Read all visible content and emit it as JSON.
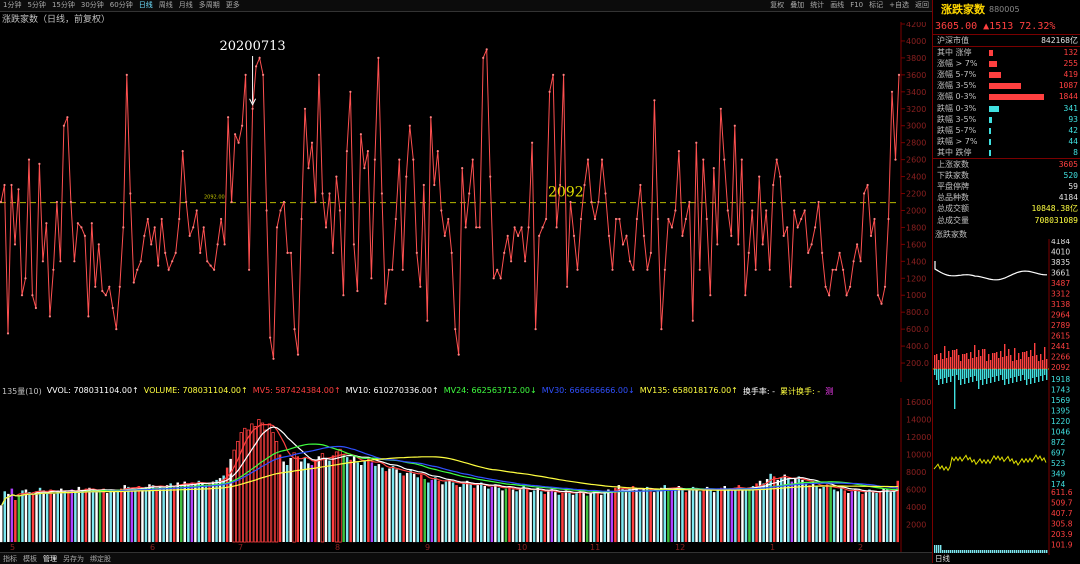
{
  "toolbar": {
    "left": [
      "1分钟",
      "5分钟",
      "15分钟",
      "30分钟",
      "60分钟",
      "日线",
      "周线",
      "月线",
      "多周期",
      "更多"
    ],
    "active": "日线",
    "right": [
      "复权",
      "叠加",
      "统计",
      "画线",
      "F10",
      "标记",
      "+自选",
      "返回"
    ]
  },
  "chart_title": "涨跌家数（日线，前复权）",
  "annotation_date": "20200713",
  "reference_line": {
    "value": 2092,
    "label": "2092",
    "small_label": "2092.00"
  },
  "price_axis": [
    "4200",
    "4000",
    "3800",
    "3600",
    "3400",
    "3200",
    "3000",
    "2800",
    "2600",
    "2400",
    "2200",
    "2000",
    "1800",
    "1600",
    "1400",
    "1200",
    "1000",
    "800.0",
    "600.0",
    "400.0",
    "200.0"
  ],
  "volume_axis": [
    "16000",
    "14000",
    "12000",
    "10000",
    "8000",
    "6000",
    "4000",
    "2000"
  ],
  "volume_info": [
    {
      "text": "135量(10)",
      "color": "#c0c0c0"
    },
    {
      "text": "VVOL: 708031104.00↑",
      "color": "#ffffff"
    },
    {
      "text": "VOLUME: 708031104.00↑",
      "color": "#ffff40"
    },
    {
      "text": "MV5: 587424384.00↑",
      "color": "#ff4040"
    },
    {
      "text": "MV10: 610270336.00↑",
      "color": "#ffffff"
    },
    {
      "text": "MV24: 662563712.00↓",
      "color": "#40ff40"
    },
    {
      "text": "MV30: 666666666.00↓",
      "color": "#3050ff"
    },
    {
      "text": "MV135: 658018176.00↑",
      "color": "#ffff40"
    },
    {
      "text": "换手率: -",
      "color": "#ffffff"
    },
    {
      "text": "累计换手: -",
      "color": "#ffff40"
    },
    {
      "text": "测",
      "color": "#ff40ff"
    }
  ],
  "month_labels": [
    "5",
    "6",
    "7",
    "8",
    "9",
    "10",
    "11",
    "12",
    "1",
    "2"
  ],
  "bottom_tabs": [
    "指标",
    "模板",
    "管理",
    "另存为",
    "绑定股"
  ],
  "bottom_active": "管理",
  "panel": {
    "name": "涨跌家数",
    "code": "880005",
    "price": "3605.00",
    "change": "▲1513",
    "pct": "72.32%",
    "market_label": "沪深市值",
    "market_value": "842168亿",
    "breakdown": [
      {
        "label": "其中 涨停",
        "value": "132",
        "color": "#ff4040",
        "bar": 132
      },
      {
        "label": "涨幅 > 7%",
        "value": "255",
        "color": "#ff4040",
        "bar": 255
      },
      {
        "label": "涨幅 5-7%",
        "value": "419",
        "color": "#ff4040",
        "bar": 419
      },
      {
        "label": "涨幅 3-5%",
        "value": "1087",
        "color": "#ff4040",
        "bar": 1087
      },
      {
        "label": "涨幅 0-3%",
        "value": "1844",
        "color": "#ff4040",
        "bar": 1844
      },
      {
        "label": "跌幅 0-3%",
        "value": "341",
        "color": "#40e0e0",
        "bar": 341
      },
      {
        "label": "跌幅 3-5%",
        "value": "93",
        "color": "#40e0e0",
        "bar": 93
      },
      {
        "label": "跌幅 5-7%",
        "value": "42",
        "color": "#40e0e0",
        "bar": 42
      },
      {
        "label": "跌幅 > 7%",
        "value": "44",
        "color": "#40e0e0",
        "bar": 44
      },
      {
        "label": "其中 跌停",
        "value": "8",
        "color": "#40e0e0",
        "bar": 8
      }
    ],
    "stats": [
      {
        "label": "上涨家数",
        "value": "3605",
        "color": "#ff4040"
      },
      {
        "label": "下跌家数",
        "value": "520",
        "color": "#40e0e0"
      },
      {
        "label": "平盘停牌",
        "value": "59",
        "color": "#e0e0e0"
      },
      {
        "label": "总品种数",
        "value": "4184",
        "color": "#e0e0e0"
      },
      {
        "label": "总成交额",
        "value": "10848.38亿",
        "color": "#ffff40"
      },
      {
        "label": "总成交量",
        "value": "708031089",
        "color": "#ffff40"
      }
    ],
    "mini_title": "涨跌家数",
    "mini_axis_upper": [
      "4184",
      "4010",
      "3835",
      "3661",
      "3487",
      "3312",
      "3138",
      "2964",
      "2789",
      "2615",
      "2441",
      "2266",
      "2092"
    ],
    "mini_axis_lower": [
      "1918",
      "1743",
      "1569",
      "1395",
      "1220",
      "1046",
      "872",
      "697",
      "523",
      "349",
      "174"
    ],
    "vol_axis": [
      "611.6",
      "509.7",
      "407.7",
      "305.8",
      "203.9",
      "101.9"
    ],
    "bottom_label": "日线"
  },
  "colors": {
    "up": "#ff4040",
    "down": "#40e0e0",
    "ref": "#b8b800",
    "accent": "#ffd700"
  },
  "chart_data": {
    "type": "line",
    "title": "涨跌家数（日线，前复权）",
    "ylim": [
      0,
      4200
    ],
    "series": [
      {
        "values": [
          2100,
          2300,
          550,
          2300,
          1600,
          2250,
          1000,
          1200,
          2600,
          1000,
          850,
          2550,
          1400,
          1850,
          750,
          1300,
          2100,
          1400,
          3000,
          3100,
          2100,
          1400,
          1850,
          1800,
          1700,
          750,
          1850,
          1100,
          1600,
          1050,
          1000,
          1100,
          850,
          600,
          1100,
          1800,
          3600,
          2200,
          1150,
          1300,
          1400,
          1700,
          1900,
          1600,
          1800,
          1350,
          1900,
          1500,
          1300,
          1400,
          1500,
          1900,
          2700,
          2100,
          1700,
          1800,
          2000,
          1500,
          1800,
          1400,
          1350,
          1300,
          1600,
          1900,
          1600,
          3100,
          2100,
          2900,
          2800,
          3000,
          3600,
          1300,
          3200,
          3700,
          3800,
          3600,
          2000,
          500,
          250,
          1800,
          2000,
          2100,
          1500,
          1500,
          600,
          300,
          1900,
          3200,
          2500,
          2800,
          2100,
          3600,
          2200,
          1800,
          2200,
          1500,
          2400,
          2000,
          1000,
          2700,
          3400,
          1600,
          1050,
          2900,
          2500,
          2700,
          1200,
          2600,
          3800,
          2200,
          900,
          1300,
          1300,
          1900,
          2600,
          1300,
          2400,
          3000,
          2600,
          1500,
          1100,
          2300,
          700,
          3100,
          2300,
          2700,
          2000,
          1700,
          1900,
          1500,
          600,
          300,
          2500,
          1800,
          2200,
          2600,
          1800,
          1800,
          3800,
          3900,
          2400,
          1200,
          1300,
          1200,
          1500,
          1700,
          1400,
          1800,
          1700,
          1800,
          1400,
          1800,
          2800,
          600,
          1700,
          1800,
          1900,
          3400,
          3600,
          1800,
          2300,
          3600,
          1100,
          2100,
          1700,
          1300,
          1900,
          2300,
          2600,
          2100,
          1900,
          2100,
          2600,
          2200,
          1700,
          1300,
          1900,
          1900,
          1600,
          1700,
          1400,
          1300,
          1900,
          2300,
          1700,
          1300,
          1500,
          3300,
          1900,
          600,
          1300,
          1900,
          1800,
          2000,
          2700,
          1700,
          1900,
          2100,
          700,
          2800,
          1300,
          2600,
          1900,
          1000,
          2500,
          1600,
          3200,
          2600,
          2000,
          1700,
          3000,
          1600,
          2600,
          1000,
          1500,
          2000,
          1300,
          2400,
          1600,
          2000,
          1300,
          2300,
          2600,
          2400,
          1700,
          1800,
          1100,
          2000,
          1800,
          1900,
          2000,
          1500,
          1600,
          1800,
          2100,
          1500,
          1100,
          1000,
          1300,
          1300,
          1500,
          1300,
          1000,
          1100,
          1400,
          1600,
          1400,
          2200,
          2300,
          1700,
          1900,
          1000,
          900,
          1100,
          1900,
          3400,
          2600,
          3600
        ]
      }
    ],
    "volume": [
      4200,
      5800,
      5500,
      6100,
      4800,
      5200,
      5900,
      6000,
      5700,
      5400,
      5800,
      6200,
      5900,
      5600,
      6000,
      5500,
      5900,
      6100,
      5800,
      5600,
      6000,
      5700,
      6300,
      5900,
      6100,
      6200,
      5800,
      5700,
      6000,
      6100,
      5600,
      5900,
      6000,
      5800,
      6100,
      6500,
      6300,
      6200,
      6000,
      6400,
      6100,
      6300,
      6600,
      6500,
      6200,
      6400,
      6100,
      6500,
      6700,
      6300,
      6800,
      6500,
      6900,
      6700,
      6800,
      6600,
      7000,
      6800,
      6500,
      6700,
      6900,
      7100,
      7300,
      7600,
      8500,
      9500,
      10500,
      11500,
      12500,
      13000,
      12800,
      13500,
      13200,
      14000,
      13600,
      12800,
      13500,
      12500,
      11500,
      10000,
      9200,
      8800,
      9600,
      10200,
      9800,
      9200,
      9600,
      9000,
      8800,
      9400,
      9800,
      10100,
      9600,
      9300,
      9900,
      10300,
      10600,
      10000,
      9700,
      9400,
      9800,
      9100,
      8800,
      9300,
      9700,
      9100,
      8700,
      8900,
      8500,
      8100,
      8400,
      8700,
      8300,
      7900,
      7600,
      7900,
      8300,
      7800,
      7400,
      7700,
      7200,
      6800,
      7100,
      7400,
      7000,
      6600,
      6900,
      7200,
      6800,
      6500,
      6300,
      6700,
      7000,
      6600,
      6200,
      6500,
      6800,
      6400,
      6100,
      6300,
      6600,
      6200,
      5900,
      6100,
      6400,
      6000,
      5800,
      6100,
      6400,
      6000,
      5700,
      5900,
      6200,
      5800,
      5500,
      5800,
      6100,
      5700,
      5400,
      5600,
      5900,
      5700,
      5400,
      5600,
      5900,
      5600,
      5300,
      5600,
      5900,
      5700,
      5400,
      5700,
      6000,
      5800,
      6200,
      6500,
      6100,
      5800,
      6100,
      6400,
      6100,
      5800,
      6000,
      6300,
      6000,
      5700,
      6000,
      6200,
      6500,
      6200,
      5900,
      6100,
      6400,
      6000,
      5700,
      5900,
      6300,
      6100,
      5800,
      6000,
      6300,
      5900,
      5700,
      5900,
      6200,
      6400,
      6100,
      5900,
      6200,
      6500,
      6200,
      5900,
      6100,
      6400,
      6700,
      7000,
      6700,
      7200,
      7800,
      7500,
      7100,
      7400,
      7700,
      7300,
      6900,
      7200,
      7500,
      7100,
      6700,
      6500,
      6800,
      6400,
      6100,
      6300,
      6600,
      6300,
      6000,
      5800,
      6200,
      5900,
      5600,
      5800,
      6100,
      5800,
      5500,
      5700,
      6000,
      5700,
      5600,
      5800,
      6100,
      6000,
      5700,
      5900,
      7000
    ]
  }
}
